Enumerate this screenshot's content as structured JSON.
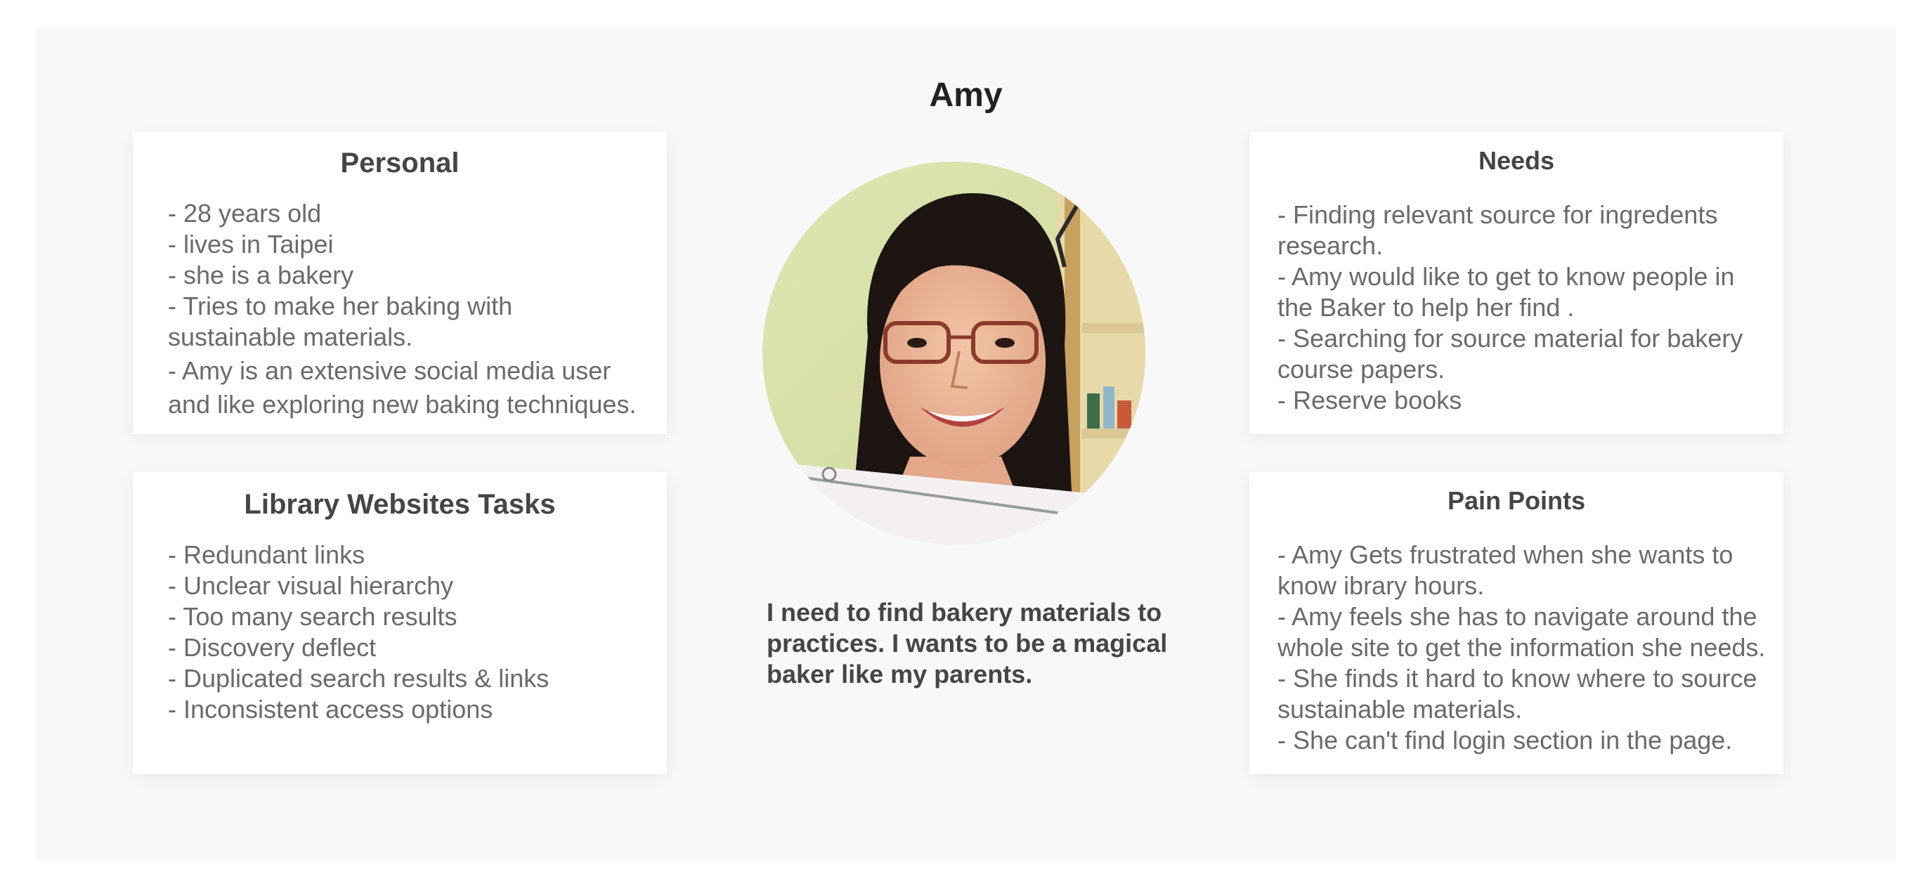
{
  "persona": {
    "name": "Amy",
    "quote": "I need to find bakery materials to practices. I wants to be a magical baker like my parents.",
    "photo_icon": "persona-photo"
  },
  "personal": {
    "title": "Personal",
    "lines": [
      "- 28 years old",
      "- lives in Taipei",
      "- she is a bakery",
      "- Tries to make her baking with",
      "sustainable materials.",
      "- Amy is an extensive social media user",
      "and like exploring new baking techniques."
    ]
  },
  "library_tasks": {
    "title": "Library Websites Tasks",
    "lines": [
      "- Redundant links",
      "- Unclear visual hierarchy",
      "- Too many search results",
      "- Discovery deflect",
      "- Duplicated search results & links",
      "- Inconsistent access options"
    ]
  },
  "needs": {
    "title": "Needs",
    "lines": [
      "- Finding relevant source for ingredents",
      "research.",
      "- Amy would like to get to know people in",
      "the Baker to help her find .",
      "- Searching for source material for bakery",
      "course papers.",
      "- Reserve books"
    ]
  },
  "pain_points": {
    "title": "Pain Points",
    "lines": [
      "- Amy Gets frustrated when she wants to",
      "know ibrary hours.",
      "- Amy feels she has to navigate around the",
      "whole site to get the information she needs.",
      "- She finds it hard to know where to source",
      "sustainable materials.",
      "- She can't find login section in the page."
    ]
  }
}
